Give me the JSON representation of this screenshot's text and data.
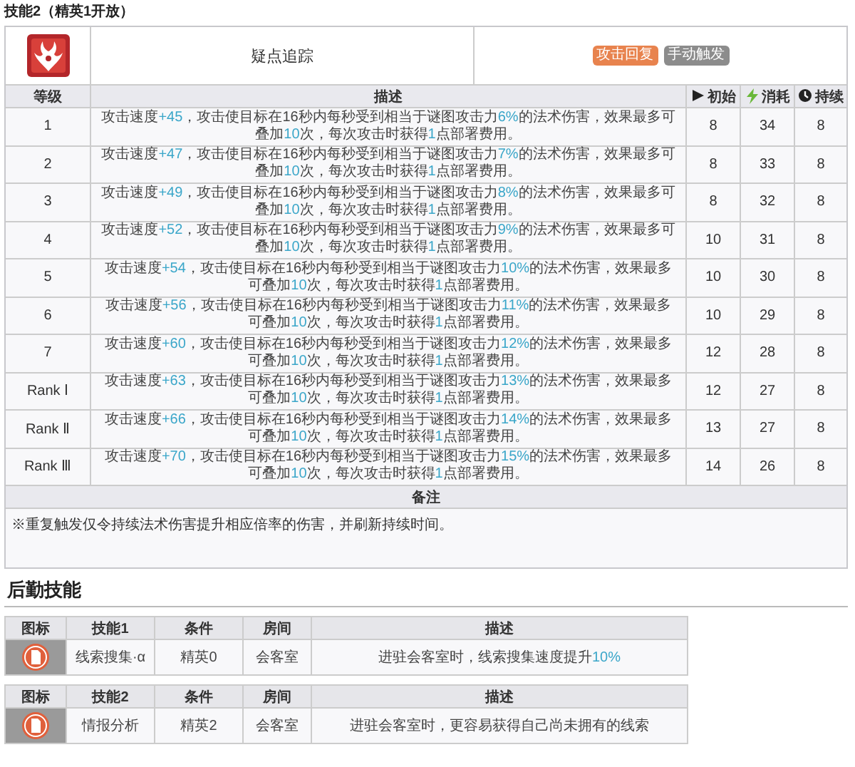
{
  "section_title": "技能2（精英1开放）",
  "skill": {
    "name": "疑点追踪",
    "tags": [
      {
        "text": "攻击回复",
        "color": "#e8834e"
      },
      {
        "text": "手动触发",
        "color": "#8c8c8c"
      }
    ]
  },
  "columns": {
    "level": "等级",
    "description": "描述",
    "initial": "初始",
    "cost": "消耗",
    "duration": "持续"
  },
  "rows": [
    {
      "level": "1",
      "description": [
        {
          "t": "攻击速度",
          "hl": false
        },
        {
          "t": "+45",
          "hl": true
        },
        {
          "t": "，攻击使目标在16秒内每秒受到相当于谜图攻击力",
          "hl": false
        },
        {
          "t": "6%",
          "hl": true
        },
        {
          "t": "的法术伤害，效果最多可叠加",
          "hl": false
        },
        {
          "t": "10",
          "hl": true
        },
        {
          "t": "次，每次攻击时获得",
          "hl": false
        },
        {
          "t": "1",
          "hl": true
        },
        {
          "t": "点部署费用。",
          "hl": false
        }
      ],
      "initial": "8",
      "cost": "34",
      "duration": "8"
    },
    {
      "level": "2",
      "description": [
        {
          "t": "攻击速度",
          "hl": false
        },
        {
          "t": "+47",
          "hl": true
        },
        {
          "t": "，攻击使目标在16秒内每秒受到相当于谜图攻击力",
          "hl": false
        },
        {
          "t": "7%",
          "hl": true
        },
        {
          "t": "的法术伤害，效果最多可叠加",
          "hl": false
        },
        {
          "t": "10",
          "hl": true
        },
        {
          "t": "次，每次攻击时获得",
          "hl": false
        },
        {
          "t": "1",
          "hl": true
        },
        {
          "t": "点部署费用。",
          "hl": false
        }
      ],
      "initial": "8",
      "cost": "33",
      "duration": "8"
    },
    {
      "level": "3",
      "description": [
        {
          "t": "攻击速度",
          "hl": false
        },
        {
          "t": "+49",
          "hl": true
        },
        {
          "t": "，攻击使目标在16秒内每秒受到相当于谜图攻击力",
          "hl": false
        },
        {
          "t": "8%",
          "hl": true
        },
        {
          "t": "的法术伤害，效果最多可叠加",
          "hl": false
        },
        {
          "t": "10",
          "hl": true
        },
        {
          "t": "次，每次攻击时获得",
          "hl": false
        },
        {
          "t": "1",
          "hl": true
        },
        {
          "t": "点部署费用。",
          "hl": false
        }
      ],
      "initial": "8",
      "cost": "32",
      "duration": "8"
    },
    {
      "level": "4",
      "description": [
        {
          "t": "攻击速度",
          "hl": false
        },
        {
          "t": "+52",
          "hl": true
        },
        {
          "t": "，攻击使目标在16秒内每秒受到相当于谜图攻击力",
          "hl": false
        },
        {
          "t": "9%",
          "hl": true
        },
        {
          "t": "的法术伤害，效果最多可叠加",
          "hl": false
        },
        {
          "t": "10",
          "hl": true
        },
        {
          "t": "次，每次攻击时获得",
          "hl": false
        },
        {
          "t": "1",
          "hl": true
        },
        {
          "t": "点部署费用。",
          "hl": false
        }
      ],
      "initial": "10",
      "cost": "31",
      "duration": "8"
    },
    {
      "level": "5",
      "description": [
        {
          "t": "攻击速度",
          "hl": false
        },
        {
          "t": "+54",
          "hl": true
        },
        {
          "t": "，攻击使目标在16秒内每秒受到相当于谜图攻击力",
          "hl": false
        },
        {
          "t": "10%",
          "hl": true
        },
        {
          "t": "的法术伤害，效果最多可叠加",
          "hl": false
        },
        {
          "t": "10",
          "hl": true
        },
        {
          "t": "次，每次攻击时获得",
          "hl": false
        },
        {
          "t": "1",
          "hl": true
        },
        {
          "t": "点部署费用。",
          "hl": false
        }
      ],
      "initial": "10",
      "cost": "30",
      "duration": "8"
    },
    {
      "level": "6",
      "description": [
        {
          "t": "攻击速度",
          "hl": false
        },
        {
          "t": "+56",
          "hl": true
        },
        {
          "t": "，攻击使目标在16秒内每秒受到相当于谜图攻击力",
          "hl": false
        },
        {
          "t": "11%",
          "hl": true
        },
        {
          "t": "的法术伤害，效果最多可叠加",
          "hl": false
        },
        {
          "t": "10",
          "hl": true
        },
        {
          "t": "次，每次攻击时获得",
          "hl": false
        },
        {
          "t": "1",
          "hl": true
        },
        {
          "t": "点部署费用。",
          "hl": false
        }
      ],
      "initial": "10",
      "cost": "29",
      "duration": "8"
    },
    {
      "level": "7",
      "description": [
        {
          "t": "攻击速度",
          "hl": false
        },
        {
          "t": "+60",
          "hl": true
        },
        {
          "t": "，攻击使目标在16秒内每秒受到相当于谜图攻击力",
          "hl": false
        },
        {
          "t": "12%",
          "hl": true
        },
        {
          "t": "的法术伤害，效果最多可叠加",
          "hl": false
        },
        {
          "t": "10",
          "hl": true
        },
        {
          "t": "次，每次攻击时获得",
          "hl": false
        },
        {
          "t": "1",
          "hl": true
        },
        {
          "t": "点部署费用。",
          "hl": false
        }
      ],
      "initial": "12",
      "cost": "28",
      "duration": "8"
    },
    {
      "level": "Rank Ⅰ",
      "description": [
        {
          "t": "攻击速度",
          "hl": false
        },
        {
          "t": "+63",
          "hl": true
        },
        {
          "t": "，攻击使目标在16秒内每秒受到相当于谜图攻击力",
          "hl": false
        },
        {
          "t": "13%",
          "hl": true
        },
        {
          "t": "的法术伤害，效果最多可叠加",
          "hl": false
        },
        {
          "t": "10",
          "hl": true
        },
        {
          "t": "次，每次攻击时获得",
          "hl": false
        },
        {
          "t": "1",
          "hl": true
        },
        {
          "t": "点部署费用。",
          "hl": false
        }
      ],
      "initial": "12",
      "cost": "27",
      "duration": "8"
    },
    {
      "level": "Rank Ⅱ",
      "description": [
        {
          "t": "攻击速度",
          "hl": false
        },
        {
          "t": "+66",
          "hl": true
        },
        {
          "t": "，攻击使目标在16秒内每秒受到相当于谜图攻击力",
          "hl": false
        },
        {
          "t": "14%",
          "hl": true
        },
        {
          "t": "的法术伤害，效果最多可叠加",
          "hl": false
        },
        {
          "t": "10",
          "hl": true
        },
        {
          "t": "次，每次攻击时获得",
          "hl": false
        },
        {
          "t": "1",
          "hl": true
        },
        {
          "t": "点部署费用。",
          "hl": false
        }
      ],
      "initial": "13",
      "cost": "27",
      "duration": "8"
    },
    {
      "level": "Rank Ⅲ",
      "description": [
        {
          "t": "攻击速度",
          "hl": false
        },
        {
          "t": "+70",
          "hl": true
        },
        {
          "t": "，攻击使目标在16秒内每秒受到相当于谜图攻击力",
          "hl": false
        },
        {
          "t": "15%",
          "hl": true
        },
        {
          "t": "的法术伤害，效果最多可叠加",
          "hl": false
        },
        {
          "t": "10",
          "hl": true
        },
        {
          "t": "次，每次攻击时获得",
          "hl": false
        },
        {
          "t": "1",
          "hl": true
        },
        {
          "t": "点部署费用。",
          "hl": false
        }
      ],
      "initial": "14",
      "cost": "26",
      "duration": "8"
    }
  ],
  "remarks": {
    "heading": "备注",
    "text": "※重复触发仅令持续法术伤害提升相应倍率的伤害，并刷新持续时间。"
  },
  "logistics": {
    "title": "后勤技能",
    "skills": [
      {
        "columns": [
          "图标",
          "技能1",
          "条件",
          "房间",
          "描述"
        ],
        "name": "线索搜集·α",
        "condition": "精英0",
        "room": "会客室",
        "description": [
          {
            "t": "进驻会客室时，线索搜集速度提升",
            "hl": false
          },
          {
            "t": "10%",
            "hl": true
          }
        ]
      },
      {
        "columns": [
          "图标",
          "技能2",
          "条件",
          "房间",
          "描述"
        ],
        "name": "情报分析",
        "condition": "精英2",
        "room": "会客室",
        "description": [
          {
            "t": "进驻会客室时，更容易获得自己尚未拥有的线索",
            "hl": false
          }
        ]
      }
    ]
  }
}
